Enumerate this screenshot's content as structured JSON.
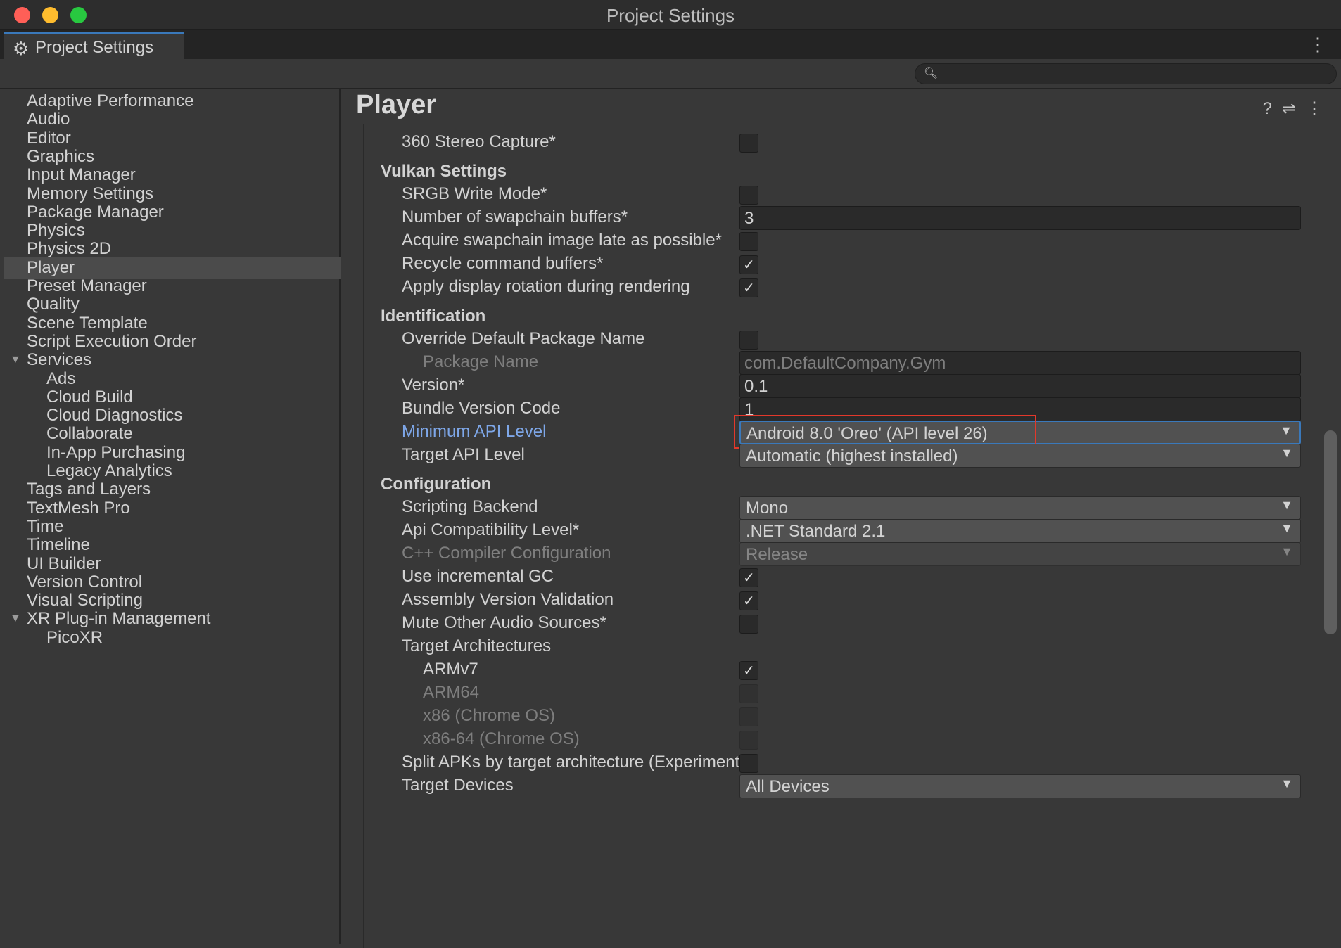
{
  "window": {
    "title": "Project Settings",
    "tab": "Project Settings"
  },
  "colors": {
    "accent": "#3a79bb",
    "highlight": "#e3382b",
    "close": "#ff5f57",
    "min": "#febc2e",
    "max": "#28c840"
  },
  "sidebar": {
    "items": [
      {
        "label": "Adaptive Performance"
      },
      {
        "label": "Audio"
      },
      {
        "label": "Editor"
      },
      {
        "label": "Graphics"
      },
      {
        "label": "Input Manager"
      },
      {
        "label": "Memory Settings"
      },
      {
        "label": "Package Manager"
      },
      {
        "label": "Physics"
      },
      {
        "label": "Physics 2D"
      },
      {
        "label": "Player",
        "selected": true
      },
      {
        "label": "Preset Manager"
      },
      {
        "label": "Quality"
      },
      {
        "label": "Scene Template"
      },
      {
        "label": "Script Execution Order"
      },
      {
        "label": "Services",
        "expanded": true
      },
      {
        "label": "Ads",
        "sub": true
      },
      {
        "label": "Cloud Build",
        "sub": true
      },
      {
        "label": "Cloud Diagnostics",
        "sub": true
      },
      {
        "label": "Collaborate",
        "sub": true
      },
      {
        "label": "In-App Purchasing",
        "sub": true
      },
      {
        "label": "Legacy Analytics",
        "sub": true
      },
      {
        "label": "Tags and Layers"
      },
      {
        "label": "TextMesh Pro"
      },
      {
        "label": "Time"
      },
      {
        "label": "Timeline"
      },
      {
        "label": "UI Builder"
      },
      {
        "label": "Version Control"
      },
      {
        "label": "Visual Scripting"
      },
      {
        "label": "XR Plug-in Management",
        "expanded": true
      },
      {
        "label": "PicoXR",
        "sub": true
      }
    ]
  },
  "main": {
    "title": "Player",
    "rows": [
      {
        "t": "cb",
        "label": "360 Stereo Capture*",
        "checked": false
      },
      {
        "t": "hdr",
        "label": "Vulkan Settings"
      },
      {
        "t": "cb",
        "label": "SRGB Write Mode*",
        "checked": false
      },
      {
        "t": "fld",
        "label": "Number of swapchain buffers*",
        "value": "3"
      },
      {
        "t": "cb",
        "label": "Acquire swapchain image late as possible*",
        "checked": false
      },
      {
        "t": "cb",
        "label": "Recycle command buffers*",
        "checked": true
      },
      {
        "t": "cb",
        "label": "Apply display rotation during rendering",
        "checked": true
      },
      {
        "t": "hdr",
        "label": "Identification"
      },
      {
        "t": "cb",
        "label": "Override Default Package Name",
        "checked": false
      },
      {
        "t": "fld",
        "label": "Package Name",
        "value": "com.DefaultCompany.Gym",
        "indent": true,
        "disabled": true
      },
      {
        "t": "fld",
        "label": "Version*",
        "value": "0.1"
      },
      {
        "t": "fld",
        "label": "Bundle Version Code",
        "value": "1"
      },
      {
        "t": "dd",
        "label": "Minimum API Level",
        "value": "Android 8.0 'Oreo' (API level 26)",
        "focus": true
      },
      {
        "t": "dd",
        "label": "Target API Level",
        "value": "Automatic (highest installed)"
      },
      {
        "t": "hdr",
        "label": "Configuration"
      },
      {
        "t": "dd",
        "label": "Scripting Backend",
        "value": "Mono"
      },
      {
        "t": "dd",
        "label": "Api Compatibility Level*",
        "value": ".NET Standard 2.1"
      },
      {
        "t": "dd",
        "label": "C++ Compiler Configuration",
        "value": "Release",
        "disabled": true
      },
      {
        "t": "cb",
        "label": "Use incremental GC",
        "checked": true
      },
      {
        "t": "cb",
        "label": "Assembly Version Validation",
        "checked": true
      },
      {
        "t": "cb",
        "label": "Mute Other Audio Sources*",
        "checked": false
      },
      {
        "t": "lbl",
        "label": "Target Architectures"
      },
      {
        "t": "cb",
        "label": "ARMv7",
        "checked": true,
        "indent": true
      },
      {
        "t": "cb",
        "label": "ARM64",
        "checked": false,
        "indent": true,
        "disabled": true
      },
      {
        "t": "cb",
        "label": "x86 (Chrome OS)",
        "checked": false,
        "indent": true,
        "disabled": true
      },
      {
        "t": "cb",
        "label": "x86-64 (Chrome OS)",
        "checked": false,
        "indent": true,
        "disabled": true
      },
      {
        "t": "cb",
        "label": "Split APKs by target architecture (Experimental)",
        "checked": false
      },
      {
        "t": "dd",
        "label": "Target Devices",
        "value": "All Devices"
      }
    ]
  }
}
